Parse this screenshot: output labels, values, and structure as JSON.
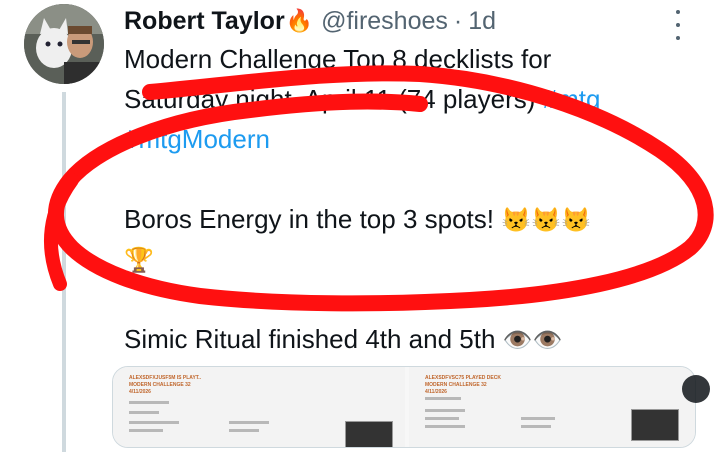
{
  "author": {
    "name": "Robert Taylor",
    "handle": "@fireshoes",
    "separator": "·",
    "time": "1d",
    "name_emoji": "🔥"
  },
  "tweet": {
    "line1": "Modern Challenge Top 8 decklists for",
    "line2_start": "Saturday night, April 11 (74 players) ",
    "tag1": "#mtg",
    "tag2": "#mtgModern",
    "line3": "Boros Energy in the top 3 spots! ",
    "cats": "😾😾😾",
    "trophy": "🏆",
    "line4": "Simic Ritual finished 4th and 5th ",
    "eyes": "👁️👁️"
  },
  "media": {
    "left_header": "ALEXSDFXJUSF5M IS PLAYT..\nMODERN CHALLENGE 32\n4/11/2026",
    "right_header": "ALEXSDFVSC75 PLAYED DECK\nMODERN CHALLENGE 32\n4/11/2026"
  },
  "colors": {
    "link": "#1d9bf0",
    "annotation": "#ff1010",
    "muted": "#536471"
  },
  "icons": [
    "more-icon",
    "fire-icon",
    "cat-emoji-icon",
    "trophy-icon",
    "eyes-icon"
  ]
}
